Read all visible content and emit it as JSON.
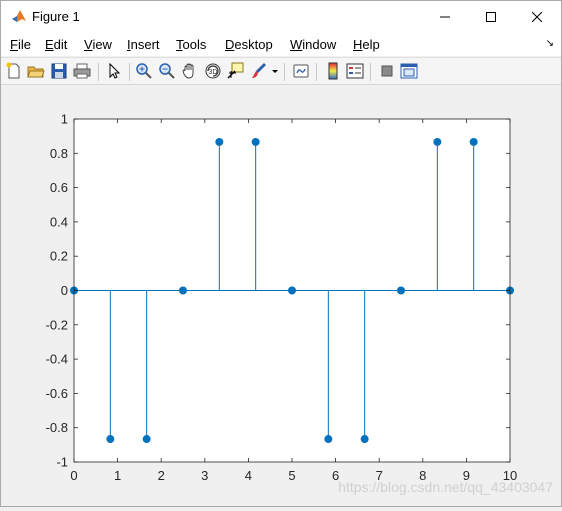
{
  "window": {
    "title": "Figure 1"
  },
  "menu": [
    {
      "u": "F",
      "rest": "ile"
    },
    {
      "u": "E",
      "rest": "dit"
    },
    {
      "u": "V",
      "rest": "iew"
    },
    {
      "u": "I",
      "rest": "nsert"
    },
    {
      "u": "T",
      "rest": "ools"
    },
    {
      "u": "D",
      "rest": "esktop"
    },
    {
      "u": "W",
      "rest": "indow"
    },
    {
      "u": "H",
      "rest": "elp"
    }
  ],
  "toolbar_icons": [
    "new-figure-icon",
    "open-file-icon",
    "save-icon",
    "print-icon",
    "edit-plot-arrow-icon",
    "zoom-in-icon",
    "zoom-out-icon",
    "pan-hand-icon",
    "rotate-3d-icon",
    "data-cursor-icon",
    "brush-icon",
    "brush-dropdown-icon",
    "link-plot-icon",
    "colorbar-icon",
    "legend-icon",
    "hide-plot-tools-icon",
    "show-plot-tools-icon"
  ],
  "chart_data": {
    "type": "stem",
    "x": [
      0,
      0.8333,
      1.6667,
      2.5,
      3.3333,
      4.1667,
      5,
      5.8333,
      6.6667,
      7.5,
      8.3333,
      9.1667,
      10
    ],
    "y": [
      0,
      -0.866,
      -0.866,
      0,
      0.866,
      0.866,
      0,
      -0.866,
      -0.866,
      0,
      0.866,
      0.866,
      0
    ],
    "xlim": [
      0,
      10
    ],
    "ylim": [
      -1,
      1
    ],
    "xticks": [
      "0",
      "1",
      "2",
      "3",
      "4",
      "5",
      "6",
      "7",
      "8",
      "9",
      "10"
    ],
    "yticks": [
      "1",
      "0.8",
      "0.6",
      "0.4",
      "0.2",
      "0",
      "-0.2",
      "-0.4",
      "-0.6",
      "-0.8",
      "-1"
    ],
    "color": "#0072BD",
    "grid": false
  },
  "watermark": "https://blog.csdn.net/qq_43403047"
}
